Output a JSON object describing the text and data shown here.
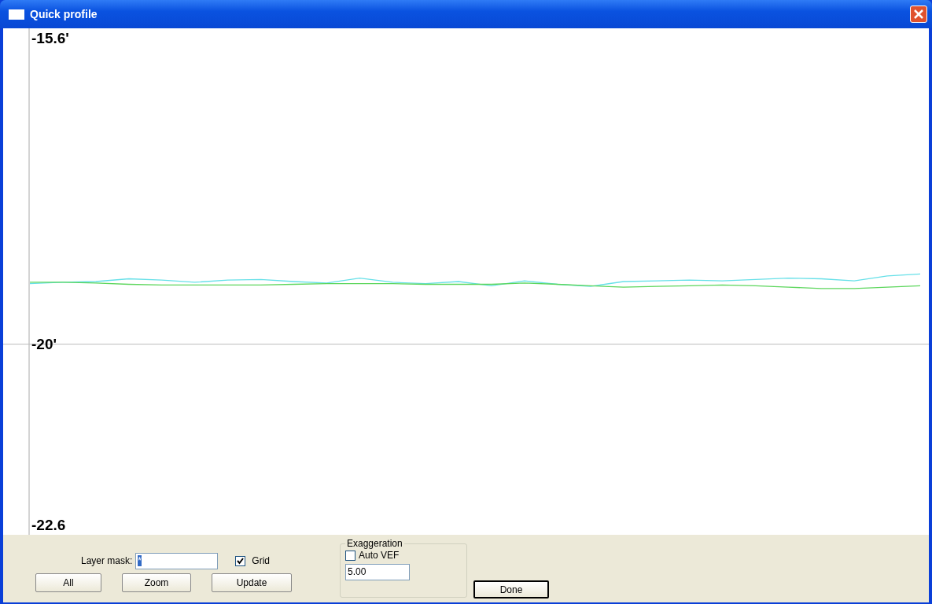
{
  "window": {
    "title": "Quick profile"
  },
  "profile": {
    "chart_data": {
      "type": "line",
      "ylim": [
        -22.74,
        -15.46
      ],
      "yticks": [
        {
          "value": -15.6,
          "label": "-15.6'"
        },
        {
          "value": -20,
          "label": "-20'"
        },
        {
          "value": -22.6,
          "label": "-22.6"
        }
      ],
      "series": [
        {
          "color": "#66e0e8",
          "values": [
            -19.13,
            -19.11,
            -19.1,
            -19.06,
            -19.08,
            -19.11,
            -19.08,
            -19.07,
            -19.1,
            -19.12,
            -19.05,
            -19.11,
            -19.13,
            -19.1,
            -19.16,
            -19.09,
            -19.14,
            -19.17,
            -19.1,
            -19.09,
            -19.08,
            -19.09,
            -19.07,
            -19.05,
            -19.06,
            -19.09,
            -19.02,
            -18.99
          ]
        },
        {
          "color": "#5cd65c",
          "values": [
            -19.11,
            -19.11,
            -19.12,
            -19.14,
            -19.15,
            -19.15,
            -19.15,
            -19.15,
            -19.14,
            -19.13,
            -19.13,
            -19.13,
            -19.14,
            -19.14,
            -19.14,
            -19.12,
            -19.14,
            -19.16,
            -19.18,
            -19.17,
            -19.16,
            -19.15,
            -19.16,
            -19.18,
            -19.2,
            -19.2,
            -19.18,
            -19.16
          ]
        }
      ]
    }
  },
  "controls": {
    "layer_mask": {
      "label": "Layer mask:",
      "value": "*"
    },
    "grid": {
      "label": "Grid",
      "checked": true
    },
    "buttons": [
      {
        "label": "All"
      },
      {
        "label": "Zoom"
      },
      {
        "label": "Update"
      }
    ],
    "exaggeration": {
      "legend": "Exaggeration",
      "auto_vef": {
        "label": "Auto VEF",
        "checked": false
      },
      "value": "5.00"
    },
    "done": {
      "label": "Done"
    }
  }
}
